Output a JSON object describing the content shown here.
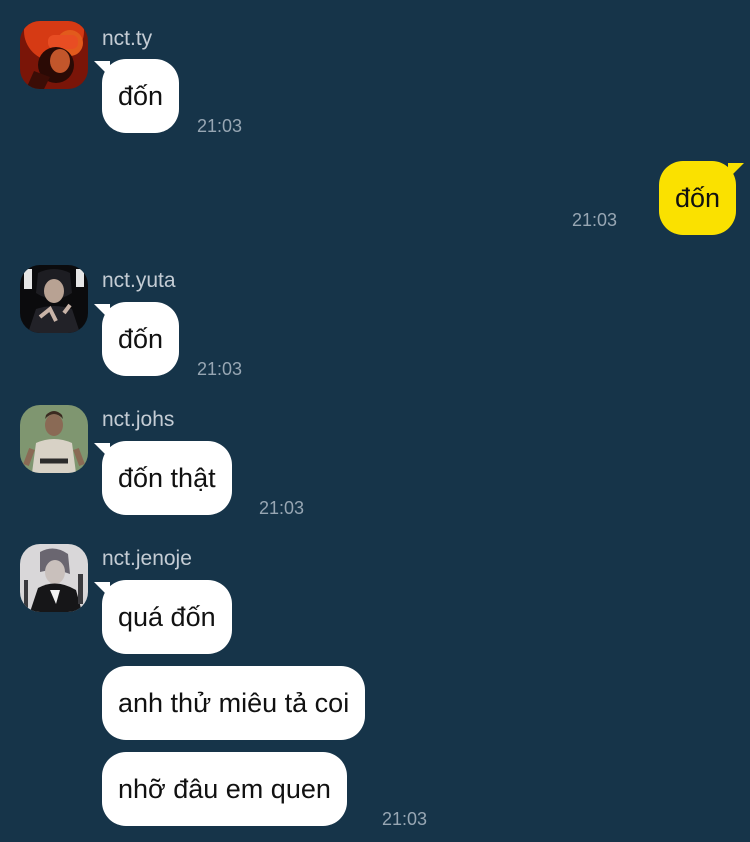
{
  "chat": {
    "messages": [
      {
        "sender": "nct.ty",
        "text": "đốn",
        "time": "21:03"
      },
      {
        "text": "đốn",
        "time": "21:03"
      },
      {
        "sender": "nct.yuta",
        "text": "đốn",
        "time": "21:03"
      },
      {
        "sender": "nct.johs",
        "text": "đốn thật",
        "time": "21:03"
      },
      {
        "sender": "nct.jenoje",
        "texts": [
          "quá đốn",
          "anh thử miêu tả coi",
          "nhỡ đâu em quen"
        ],
        "time": "21:03"
      }
    ]
  },
  "colors": {
    "background": "#163449",
    "incoming_bubble": "#ffffff",
    "outgoing_bubble": "#fae100",
    "name_text": "#c4ccd4",
    "time_text": "#97a6b3"
  }
}
